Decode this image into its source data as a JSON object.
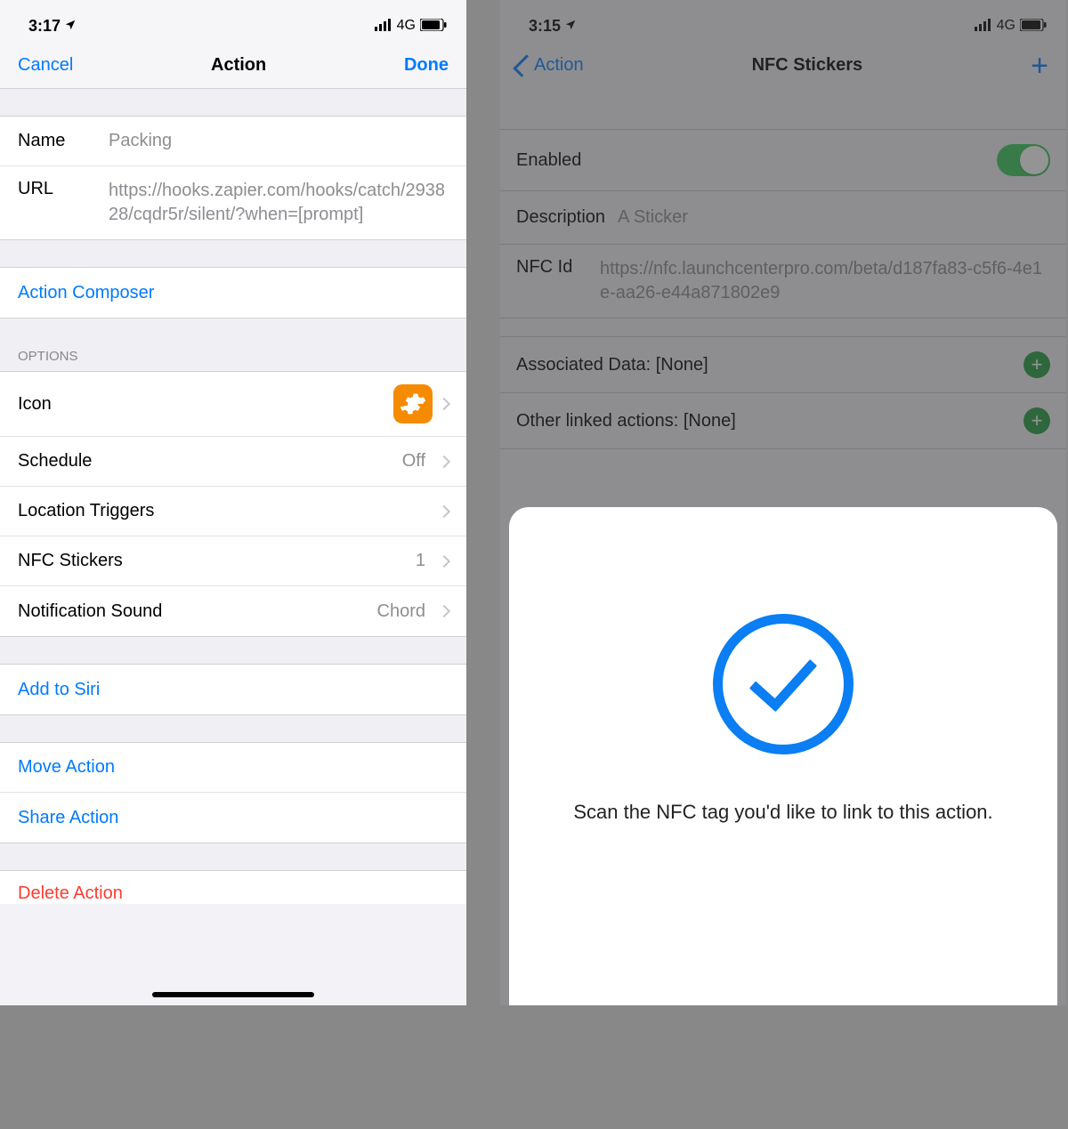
{
  "left": {
    "status": {
      "time": "3:17",
      "network": "4G"
    },
    "nav": {
      "cancel": "Cancel",
      "title": "Action",
      "done": "Done"
    },
    "fields": {
      "name_label": "Name",
      "name_value": "Packing",
      "url_label": "URL",
      "url_value": "https://hooks.zapier.com/hooks/catch/293828/cqdr5r/silent/?when=[prompt]"
    },
    "action_composer": "Action Composer",
    "options_header": "OPTIONS",
    "options": {
      "icon": "Icon",
      "schedule": "Schedule",
      "schedule_value": "Off",
      "location": "Location Triggers",
      "nfc": "NFC Stickers",
      "nfc_value": "1",
      "notification": "Notification Sound",
      "notification_value": "Chord"
    },
    "siri": "Add to Siri",
    "move": "Move Action",
    "share": "Share Action",
    "delete": "Delete Action"
  },
  "right": {
    "status": {
      "time": "3:15",
      "network": "4G"
    },
    "nav": {
      "back": "Action",
      "title": "NFC Stickers"
    },
    "rows": {
      "enabled": "Enabled",
      "description_label": "Description",
      "description_value": "A Sticker",
      "nfcid_label": "NFC Id",
      "nfcid_value": "https://nfc.launchcenterpro.com/beta/d187fa83-c5f6-4e1e-aa26-e44a871802e9",
      "associated": "Associated Data: [None]",
      "linked": "Other linked actions: [None]"
    },
    "sheet": {
      "text": "Scan the NFC tag you'd like to link to this action."
    }
  }
}
